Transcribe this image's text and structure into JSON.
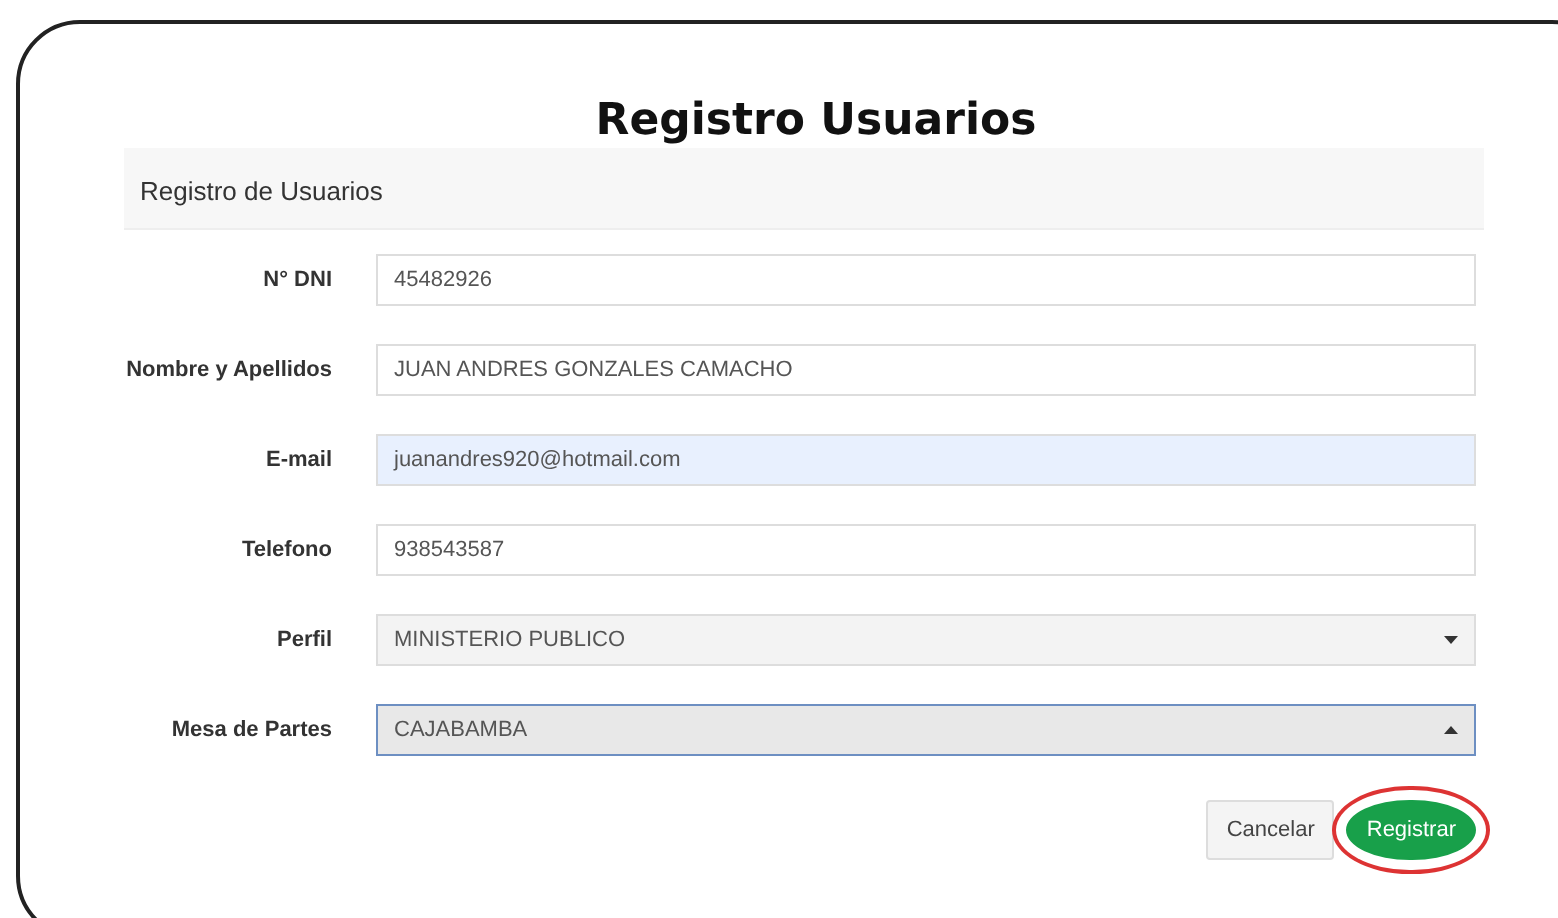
{
  "title": "Registro Usuarios",
  "panel": {
    "heading": "Registro de Usuarios"
  },
  "fields": [
    {
      "label": "N° DNI",
      "kind": "text",
      "value": "45482926",
      "autofilled": false
    },
    {
      "label": "Nombre y Apellidos",
      "kind": "text",
      "value": "JUAN ANDRES GONZALES CAMACHO",
      "autofilled": false
    },
    {
      "label": "E-mail",
      "kind": "text",
      "value": "juanandres920@hotmail.com",
      "autofilled": true
    },
    {
      "label": "Telefono",
      "kind": "text",
      "value": "938543587",
      "autofilled": false
    },
    {
      "label": "Perfil",
      "kind": "select",
      "value": "MINISTERIO PUBLICO",
      "expanded": false
    },
    {
      "label": "Mesa de Partes",
      "kind": "select",
      "value": "CAJABAMBA",
      "expanded": true
    }
  ],
  "buttons": [
    {
      "label": "Cancelar",
      "kind": "secondary",
      "circled": false
    },
    {
      "label": "Registrar",
      "kind": "primary",
      "circled": true
    }
  ]
}
